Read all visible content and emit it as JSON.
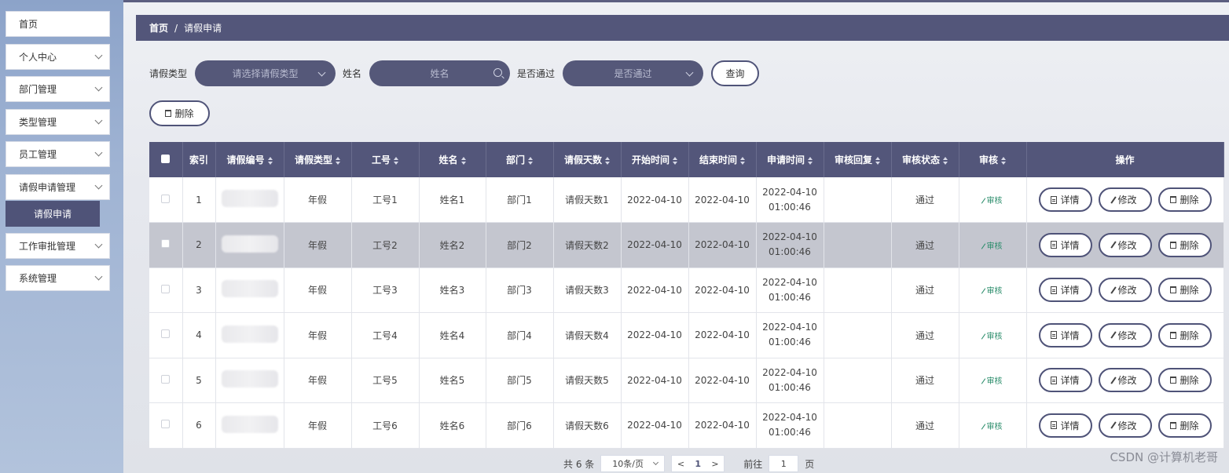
{
  "sidebar": {
    "items": [
      {
        "label": "首页",
        "expandable": false
      },
      {
        "label": "个人中心",
        "expandable": true
      },
      {
        "label": "部门管理",
        "expandable": true
      },
      {
        "label": "类型管理",
        "expandable": true
      },
      {
        "label": "员工管理",
        "expandable": true
      },
      {
        "label": "请假申请管理",
        "expandable": true
      },
      {
        "label": "工作审批管理",
        "expandable": true
      },
      {
        "label": "系统管理",
        "expandable": true
      }
    ],
    "active_sub": "请假申请"
  },
  "breadcrumb": {
    "home": "首页",
    "sep": "/",
    "current": "请假申请"
  },
  "search": {
    "type_label": "请假类型",
    "type_placeholder": "请选择请假类型",
    "name_label": "姓名",
    "name_placeholder": "姓名",
    "pass_label": "是否通过",
    "pass_placeholder": "是否通过",
    "query_button": "查询"
  },
  "toolbar": {
    "delete_label": "删除"
  },
  "table": {
    "headers": [
      "索引",
      "请假编号",
      "请假类型",
      "工号",
      "姓名",
      "部门",
      "请假天数",
      "开始时间",
      "结束时间",
      "申请时间",
      "审核回复",
      "审核状态",
      "审核",
      "操作"
    ],
    "rows": [
      {
        "index": "1",
        "type": "年假",
        "job_no": "工号1",
        "name": "姓名1",
        "dept": "部门1",
        "days": "请假天数1",
        "start": "2022-04-10",
        "end": "2022-04-10",
        "apply_date": "2022-04-10",
        "apply_time": "01:00:46",
        "reply": "",
        "status": "通过",
        "audit": "审核"
      },
      {
        "index": "2",
        "type": "年假",
        "job_no": "工号2",
        "name": "姓名2",
        "dept": "部门2",
        "days": "请假天数2",
        "start": "2022-04-10",
        "end": "2022-04-10",
        "apply_date": "2022-04-10",
        "apply_time": "01:00:46",
        "reply": "",
        "status": "通过",
        "audit": "审核"
      },
      {
        "index": "3",
        "type": "年假",
        "job_no": "工号3",
        "name": "姓名3",
        "dept": "部门3",
        "days": "请假天数3",
        "start": "2022-04-10",
        "end": "2022-04-10",
        "apply_date": "2022-04-10",
        "apply_time": "01:00:46",
        "reply": "",
        "status": "通过",
        "audit": "审核"
      },
      {
        "index": "4",
        "type": "年假",
        "job_no": "工号4",
        "name": "姓名4",
        "dept": "部门4",
        "days": "请假天数4",
        "start": "2022-04-10",
        "end": "2022-04-10",
        "apply_date": "2022-04-10",
        "apply_time": "01:00:46",
        "reply": "",
        "status": "通过",
        "audit": "审核"
      },
      {
        "index": "5",
        "type": "年假",
        "job_no": "工号5",
        "name": "姓名5",
        "dept": "部门5",
        "days": "请假天数5",
        "start": "2022-04-10",
        "end": "2022-04-10",
        "apply_date": "2022-04-10",
        "apply_time": "01:00:46",
        "reply": "",
        "status": "通过",
        "audit": "审核"
      },
      {
        "index": "6",
        "type": "年假",
        "job_no": "工号6",
        "name": "姓名6",
        "dept": "部门6",
        "days": "请假天数6",
        "start": "2022-04-10",
        "end": "2022-04-10",
        "apply_date": "2022-04-10",
        "apply_time": "01:00:46",
        "reply": "",
        "status": "通过",
        "audit": "审核"
      }
    ],
    "actions": {
      "detail": "详情",
      "edit": "修改",
      "delete": "删除"
    },
    "highlighted_row": 2
  },
  "pager": {
    "total": "共 6 条",
    "page_size": "10条/页",
    "prev": "<",
    "current": "1",
    "next": ">",
    "goto_label": "前往",
    "goto_value": "1",
    "page_suffix": "页"
  },
  "watermark": "CSDN @计算机老哥",
  "colors": {
    "primary": "#53567a",
    "accent_green": "#2a8c6a"
  }
}
